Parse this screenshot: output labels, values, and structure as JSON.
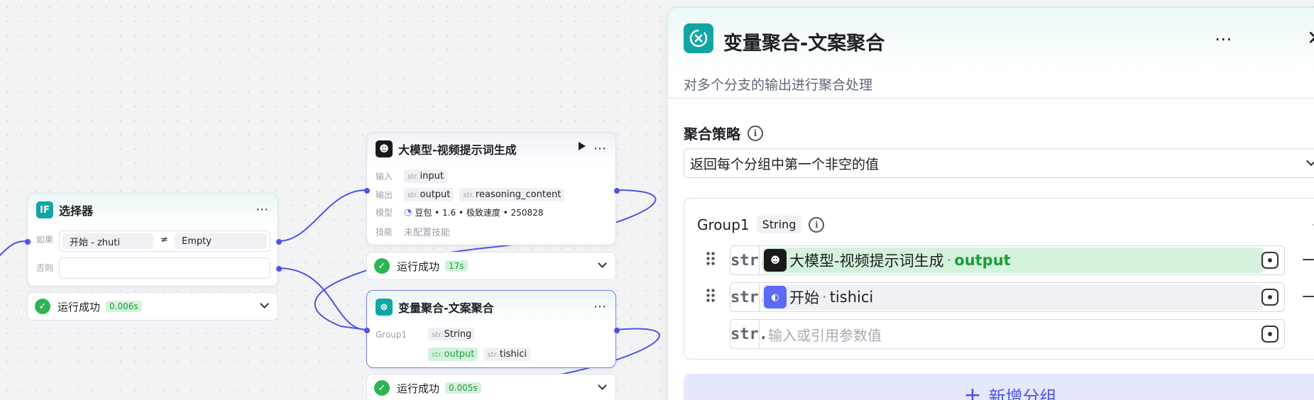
{
  "selector_node": {
    "title": "选择器",
    "if_label": "如果",
    "else_label": "否则",
    "condition_left": "开始  -  zhuti",
    "condition_op": "≠",
    "condition_right": "Empty",
    "status": "运行成功",
    "time": "0.006s"
  },
  "llm_node": {
    "title": "大模型-视频提示词生成",
    "input_label": "输入",
    "input_var": "input",
    "output_label": "输出",
    "output_vars": [
      "output",
      "reasoning_content"
    ],
    "model_label": "模型",
    "model_value": "豆包 • 1.6 • 极致速度 • 250828",
    "skill_label": "技能",
    "skill_value": "未配置技能",
    "status": "运行成功",
    "time": "17s"
  },
  "agg_node": {
    "title": "变量聚合-文案聚合",
    "group_label": "Group1",
    "group_type": "String",
    "vars": [
      "output",
      "tishici"
    ],
    "status": "运行成功",
    "time": "0.005s"
  },
  "type_prefix": "str.",
  "panel": {
    "title": "变量聚合-文案聚合",
    "description": "对多个分支的输出进行聚合处理",
    "strategy_label": "聚合策略",
    "strategy_value": "返回每个分组中第一个非空的值",
    "group_name": "Group1",
    "group_type": "String",
    "rows": [
      {
        "source": "大模型-视频提示词生成",
        "var": "output"
      },
      {
        "source": "开始",
        "var": "tishici"
      }
    ],
    "input_placeholder": "输入或引用参数值",
    "add_group_label": "新增分组"
  },
  "colors": {
    "accent": "#4d53e8",
    "teal": "#12a5a5",
    "success": "#2fb455"
  }
}
